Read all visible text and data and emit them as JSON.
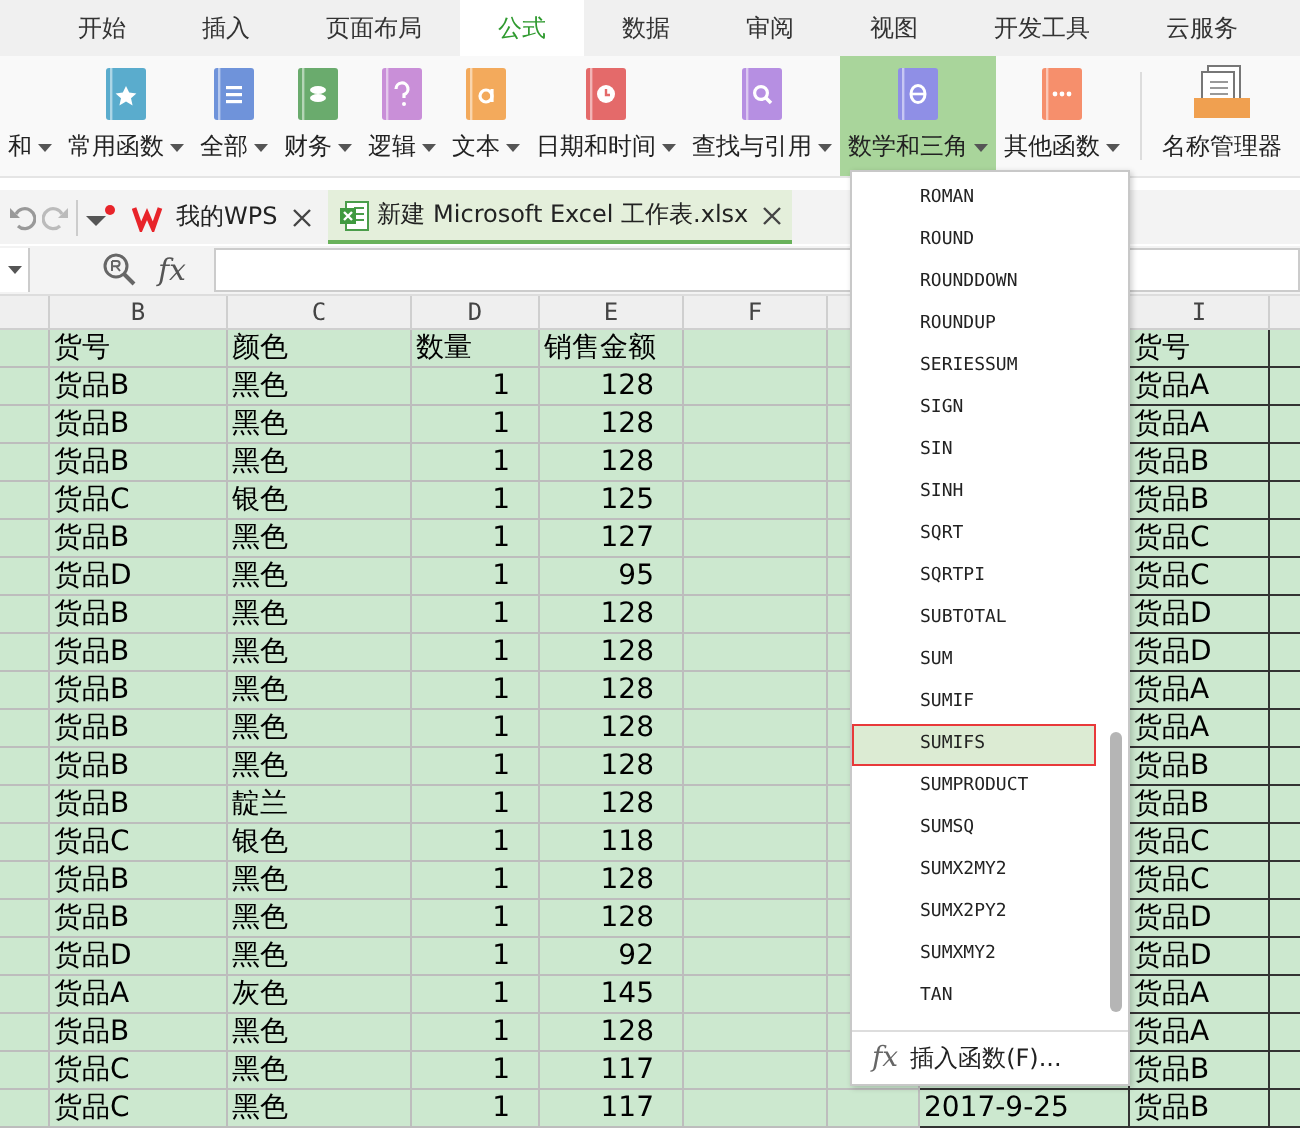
{
  "menu_tabs": [
    {
      "label": "开始",
      "selected": false
    },
    {
      "label": "插入",
      "selected": false
    },
    {
      "label": "页面布局",
      "selected": false
    },
    {
      "label": "公式",
      "selected": true
    },
    {
      "label": "数据",
      "selected": false
    },
    {
      "label": "审阅",
      "selected": false
    },
    {
      "label": "视图",
      "selected": false
    },
    {
      "label": "开发工具",
      "selected": false
    },
    {
      "label": "云服务",
      "selected": false
    }
  ],
  "ribbon_buttons": [
    {
      "label": "和",
      "selected": false
    },
    {
      "label": "常用函数",
      "color": "#5aaccd",
      "selected": false
    },
    {
      "label": "全部",
      "color": "#6f93da",
      "selected": false
    },
    {
      "label": "财务",
      "color": "#6aab6d",
      "selected": false
    },
    {
      "label": "逻辑",
      "color": "#c98fd8",
      "selected": false
    },
    {
      "label": "文本",
      "color": "#f3aa5c",
      "selected": false
    },
    {
      "label": "日期和时间",
      "color": "#e46a6a",
      "selected": false
    },
    {
      "label": "查找与引用",
      "color": "#b68fe2",
      "selected": false
    },
    {
      "label": "数学和三角",
      "color": "#8f8fe6",
      "selected": true
    },
    {
      "label": "其他函数",
      "color": "#f68f6c",
      "selected": false
    }
  ],
  "name_manager": {
    "label": "名称管理器"
  },
  "doc_tabs": [
    {
      "label": "我的WPS",
      "kind": "wps",
      "selected": false
    },
    {
      "label": "新建 Microsoft Excel 工作表.xlsx",
      "kind": "excel",
      "selected": true
    }
  ],
  "formula_bar": {
    "fx": "fx"
  },
  "sheet": {
    "left_columns": [
      "B",
      "C",
      "D",
      "E",
      "F"
    ],
    "right_columns": [
      "I"
    ],
    "rows": [
      {
        "kind": "header",
        "B": "货号",
        "C": "颜色",
        "D": "数量",
        "E": "销售金额",
        "I": "货号"
      },
      {
        "kind": "data",
        "B": "货品B",
        "C": "黑色",
        "D": "1",
        "E": "128",
        "I": "货品A"
      },
      {
        "kind": "data",
        "B": "货品B",
        "C": "黑色",
        "D": "1",
        "E": "128",
        "I": "货品A"
      },
      {
        "kind": "data",
        "B": "货品B",
        "C": "黑色",
        "D": "1",
        "E": "128",
        "I": "货品B"
      },
      {
        "kind": "data",
        "B": "货品C",
        "C": "银色",
        "D": "1",
        "E": "125",
        "I": "货品B"
      },
      {
        "kind": "data",
        "B": "货品B",
        "C": "黑色",
        "D": "1",
        "E": "127",
        "I": "货品C"
      },
      {
        "kind": "data",
        "B": "货品D",
        "C": "黑色",
        "D": "1",
        "E": "95",
        "I": "货品C"
      },
      {
        "kind": "data",
        "B": "货品B",
        "C": "黑色",
        "D": "1",
        "E": "128",
        "I": "货品D"
      },
      {
        "kind": "data",
        "B": "货品B",
        "C": "黑色",
        "D": "1",
        "E": "128",
        "I": "货品D"
      },
      {
        "kind": "data",
        "B": "货品B",
        "C": "黑色",
        "D": "1",
        "E": "128",
        "I": "货品A"
      },
      {
        "kind": "data",
        "B": "货品B",
        "C": "黑色",
        "D": "1",
        "E": "128",
        "I": "货品A"
      },
      {
        "kind": "data",
        "B": "货品B",
        "C": "黑色",
        "D": "1",
        "E": "128",
        "I": "货品B"
      },
      {
        "kind": "data",
        "B": "货品B",
        "C": "靛兰",
        "D": "1",
        "E": "128",
        "I": "货品B"
      },
      {
        "kind": "data",
        "B": "货品C",
        "C": "银色",
        "D": "1",
        "E": "118",
        "I": "货品C"
      },
      {
        "kind": "data",
        "B": "货品B",
        "C": "黑色",
        "D": "1",
        "E": "128",
        "I": "货品C"
      },
      {
        "kind": "data",
        "B": "货品B",
        "C": "黑色",
        "D": "1",
        "E": "128",
        "I": "货品D"
      },
      {
        "kind": "data",
        "B": "货品D",
        "C": "黑色",
        "D": "1",
        "E": "92",
        "I": "货品D"
      },
      {
        "kind": "data",
        "B": "货品A",
        "C": "灰色",
        "D": "1",
        "E": "145",
        "I": "货品A"
      },
      {
        "kind": "data",
        "B": "货品B",
        "C": "黑色",
        "D": "1",
        "E": "128",
        "I": "货品A"
      },
      {
        "kind": "data",
        "B": "货品C",
        "C": "黑色",
        "D": "1",
        "E": "117",
        "I": "货品B"
      },
      {
        "kind": "data",
        "B": "货品C",
        "C": "黑色",
        "D": "1",
        "E": "117",
        "H": "2017-9-25",
        "I": "货品B"
      }
    ]
  },
  "function_menu": {
    "items": [
      {
        "label": "ROMAN",
        "selected": false
      },
      {
        "label": "ROUND",
        "selected": false
      },
      {
        "label": "ROUNDDOWN",
        "selected": false
      },
      {
        "label": "ROUNDUP",
        "selected": false
      },
      {
        "label": "SERIESSUM",
        "selected": false
      },
      {
        "label": "SIGN",
        "selected": false
      },
      {
        "label": "SIN",
        "selected": false
      },
      {
        "label": "SINH",
        "selected": false
      },
      {
        "label": "SQRT",
        "selected": false
      },
      {
        "label": "SQRTPI",
        "selected": false
      },
      {
        "label": "SUBTOTAL",
        "selected": false
      },
      {
        "label": "SUM",
        "selected": false
      },
      {
        "label": "SUMIF",
        "selected": false
      },
      {
        "label": "SUMIFS",
        "selected": true
      },
      {
        "label": "SUMPRODUCT",
        "selected": false
      },
      {
        "label": "SUMSQ",
        "selected": false
      },
      {
        "label": "SUMX2MY2",
        "selected": false
      },
      {
        "label": "SUMX2PY2",
        "selected": false
      },
      {
        "label": "SUMXMY2",
        "selected": false
      },
      {
        "label": "TAN",
        "selected": false
      }
    ],
    "footer": {
      "fx": "fx",
      "label": "插入函数(F)..."
    }
  }
}
